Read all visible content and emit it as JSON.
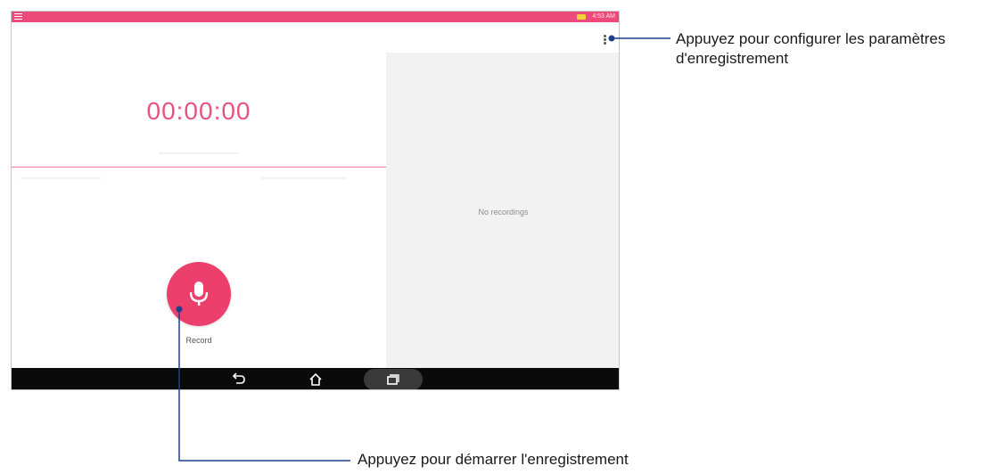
{
  "status_bar": {
    "time": "4:53 AM",
    "menu_icon": "hamburger-icon",
    "battery_icon": "battery-icon"
  },
  "recorder": {
    "timer": "00:00:00",
    "record_label": "Record",
    "mic_icon": "microphone-icon"
  },
  "recordings_panel": {
    "empty_text": "No recordings"
  },
  "app_bar": {
    "overflow_icon": "more-vert-icon"
  },
  "nav_bar": {
    "back_icon": "back-icon",
    "home_icon": "home-icon",
    "recents_icon": "recents-icon"
  },
  "annotations": {
    "settings_line1": "Appuyez pour configurer les paramètres",
    "settings_line2": "d'enregistrement",
    "record": "Appuyez pour démarrer l'enregistrement"
  },
  "colors": {
    "accent": "#ec3f6c",
    "status_bar": "#ec4a7a",
    "timer_text": "#e8547f",
    "callout_line": "#1f3f8a"
  }
}
